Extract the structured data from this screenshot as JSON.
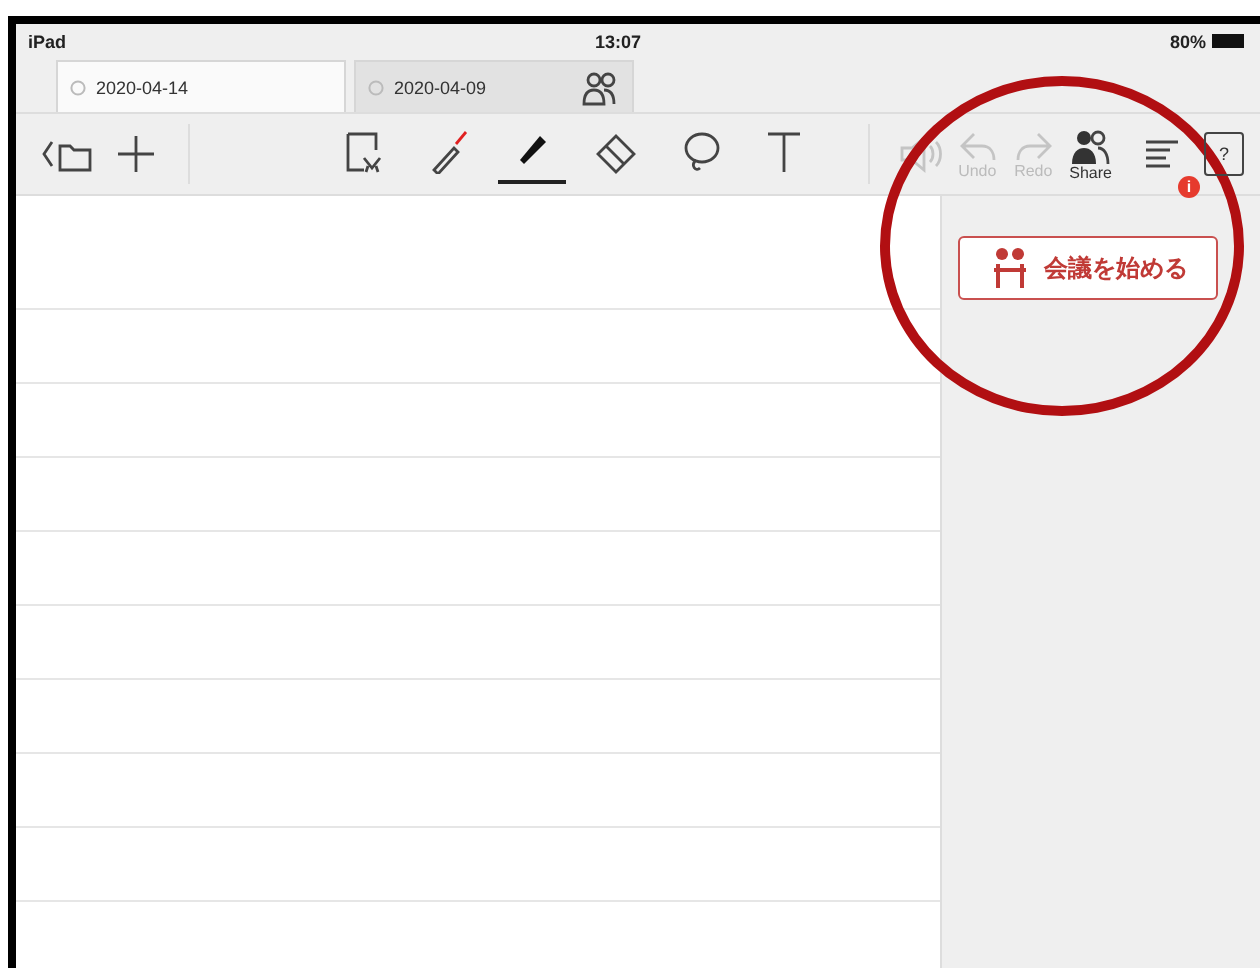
{
  "status_bar": {
    "device": "iPad",
    "time": "13:07",
    "battery": "80%"
  },
  "tabs": [
    {
      "label": "2020-04-14",
      "selected": true,
      "shared": false
    },
    {
      "label": "2020-04-09",
      "selected": false,
      "shared": true
    }
  ],
  "toolbar": {
    "left": [
      {
        "kind": "folder"
      },
      {
        "kind": "add"
      }
    ],
    "tools": [
      {
        "kind": "select",
        "selected": false
      },
      {
        "kind": "laser",
        "selected": false
      },
      {
        "kind": "pen",
        "selected": true
      },
      {
        "kind": "eraser",
        "selected": false
      },
      {
        "kind": "lasso",
        "selected": false
      },
      {
        "kind": "text",
        "selected": false
      }
    ],
    "actions": [
      {
        "kind": "audio",
        "disabled": true
      },
      {
        "kind": "undo",
        "label": "Undo",
        "disabled": true
      },
      {
        "kind": "redo",
        "label": "Redo",
        "disabled": true
      },
      {
        "kind": "share",
        "label": "Share",
        "disabled": false
      }
    ],
    "info_badge": "i",
    "help_glyph": "?"
  },
  "side_panel": {
    "button": "会議を始める"
  },
  "annotation": {
    "kind": "circle"
  }
}
